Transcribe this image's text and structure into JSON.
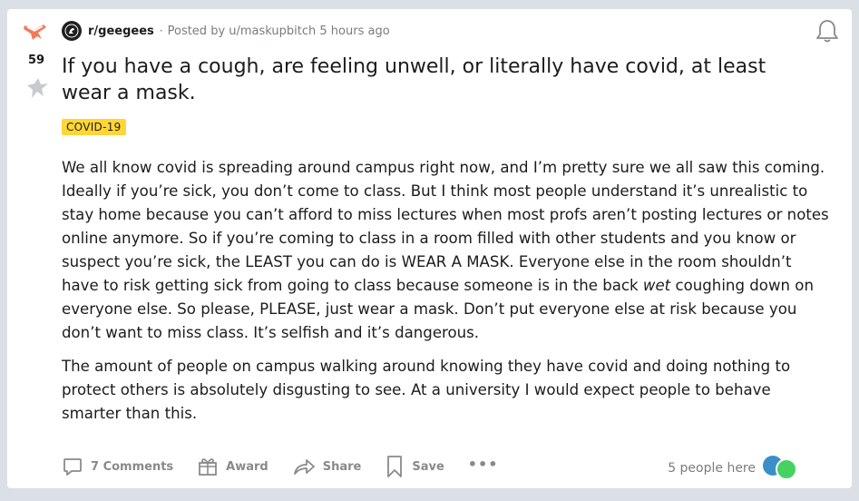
{
  "post": {
    "score": "59",
    "subreddit": "r/geegees",
    "posted_by": "Posted by u/maskupbitch 5 hours ago",
    "title": "If you have a cough, are feeling unwell, or literally have covid, at least wear a mask.",
    "flair": "COVID-19",
    "flair_color": "#ffd635",
    "body": {
      "p1_a": "We all know covid is spreading around campus right now, and I’m pretty sure we all saw this coming. Ideally if you’re sick, you don’t come to class. But I think most people understand it’s unrealistic to stay home because you can’t afford to miss lectures when most profs aren’t posting lectures or notes online anymore. So if you’re coming to class in a room filled with other students and you know or suspect you’re sick, the LEAST you can do is WEAR A MASK. Everyone else in the room shouldn’t have to risk getting sick from going to class because someone is in the back ",
      "p1_italic": "wet",
      "p1_b": " coughing down on everyone else. So please, PLEASE, just wear a mask. Don’t put everyone else at risk because you don’t want to miss class. It’s selfish and it’s dangerous.",
      "p2": "The amount of people on campus walking around knowing they have covid and doing nothing to protect others is absolutely disgusting to see. At a university I would expect people to behave smarter than this."
    }
  },
  "actions": {
    "comments": "7 Comments",
    "award": "Award",
    "share": "Share",
    "save": "Save",
    "more": "•••"
  },
  "presence": {
    "text": "5 people here"
  },
  "icons": {
    "upvote": "upvote-icon",
    "downvote": "downvote-icon",
    "bell": "bell-icon",
    "comment": "comment-icon",
    "award": "award-icon",
    "share": "share-icon",
    "save": "save-icon"
  }
}
